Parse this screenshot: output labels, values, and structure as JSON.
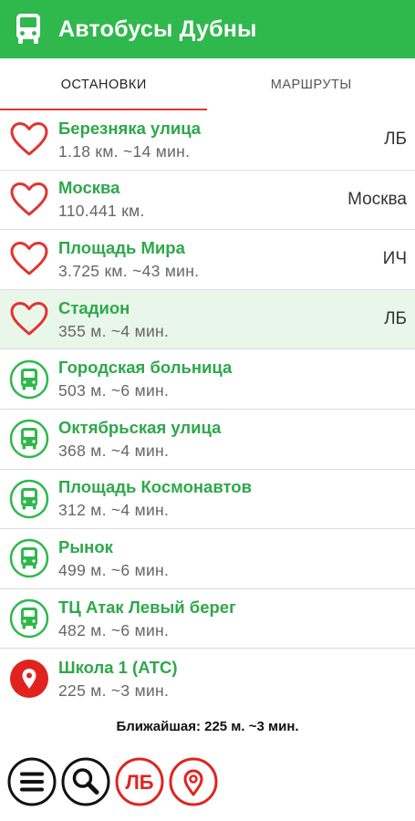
{
  "app": {
    "title": "Автобусы Дубны",
    "icon": "bus-icon",
    "bar_color": "#2fb84c"
  },
  "tabs": [
    {
      "label": "ОСТАНОВКИ",
      "active": true
    },
    {
      "label": "МАРШРУТЫ",
      "active": false
    }
  ],
  "stops": [
    {
      "icon": "heart-icon",
      "name": "Березняка улица",
      "distance": "1.18 км. ~14 мин.",
      "route": "ЛБ"
    },
    {
      "icon": "heart-icon",
      "name": "Москва",
      "distance": "110.441 км.",
      "route": "Москва"
    },
    {
      "icon": "heart-icon",
      "name": "Площадь Мира",
      "distance": "3.725 км. ~43 мин.",
      "route": "ИЧ"
    },
    {
      "icon": "heart-icon",
      "name": "Стадион",
      "distance": "355 м. ~4 мин.",
      "route": "ЛБ",
      "highlighted": true
    },
    {
      "icon": "bus-stop-icon",
      "name": "Городская больница",
      "distance": "503 м. ~6 мин.",
      "route": ""
    },
    {
      "icon": "bus-stop-icon",
      "name": "Октябрьская улица",
      "distance": "368 м. ~4 мин.",
      "route": ""
    },
    {
      "icon": "bus-stop-icon",
      "name": "Площадь Космонавтов",
      "distance": "312 м. ~4 мин.",
      "route": ""
    },
    {
      "icon": "bus-stop-icon",
      "name": "Рынок",
      "distance": "499 м. ~6 мин.",
      "route": ""
    },
    {
      "icon": "bus-stop-icon",
      "name": "ТЦ Атак Левый берег",
      "distance": "482 м. ~6 мин.",
      "route": ""
    },
    {
      "icon": "location-pin-icon",
      "name": "Школа 1 (АТС)",
      "distance": "225 м. ~3 мин.",
      "route": ""
    }
  ],
  "nearest": "Ближайшая: 225 м. ~3 мин.",
  "toolbar": {
    "menu_icon": "menu-icon",
    "search_icon": "search-icon",
    "lb_label": "ЛБ",
    "location_icon": "location-pin-icon"
  },
  "colors": {
    "green": "#2ea84a",
    "red": "#e0342f",
    "highlight": "#e9f6ea"
  }
}
